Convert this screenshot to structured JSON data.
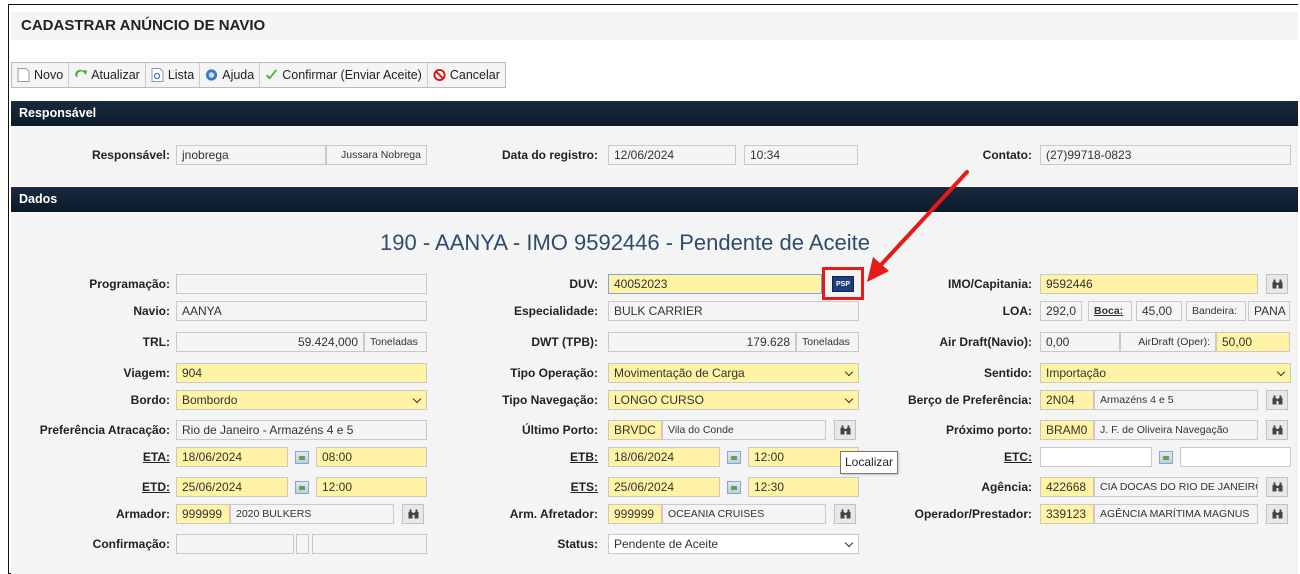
{
  "page_title": "CADASTRAR ANÚNCIO DE NAVIO",
  "toolbar": {
    "novo": "Novo",
    "atualizar": "Atualizar",
    "lista": "Lista",
    "ajuda": "Ajuda",
    "confirmar": "Confirmar (Enviar Aceite)",
    "cancelar": "Cancelar"
  },
  "responsavel_section": {
    "title": "Responsável",
    "responsavel_label": "Responsável:",
    "responsavel_user": "jnobrega",
    "responsavel_name": "Jussara Nobrega",
    "data_label": "Data do registro:",
    "data": "12/06/2024",
    "hora": "10:34",
    "contato_label": "Contato:",
    "contato": "(27)99718-0823"
  },
  "dados_section": {
    "title": "Dados",
    "heading": "190 - AANYA - IMO 9592446 - Pendente de Aceite"
  },
  "col1": {
    "programacao_label": "Programação:",
    "programacao": "",
    "navio_label": "Navio:",
    "navio": "AANYA",
    "trl_label": "TRL:",
    "trl": "59.424,000",
    "trl_unit": "Toneladas",
    "viagem_label": "Viagem:",
    "viagem": "904",
    "bordo_label": "Bordo:",
    "bordo": "Bombordo",
    "pref_label": "Preferência Atracação:",
    "pref": "Rio de Janeiro - Armazéns 4 e 5",
    "eta_label": "ETA:",
    "eta_date": "18/06/2024",
    "eta_time": "08:00",
    "etd_label": "ETD:",
    "etd_date": "25/06/2024",
    "etd_time": "12:00",
    "armador_label": "Armador:",
    "armador_code": "999999",
    "armador_name": "2020 BULKERS",
    "confirmacao_label": "Confirmação:"
  },
  "col2": {
    "duv_label": "DUV:",
    "duv": "40052023",
    "especialidade_label": "Especialidade:",
    "especialidade": "BULK CARRIER",
    "dwt_label": "DWT (TPB):",
    "dwt": "179.628",
    "dwt_unit": "Toneladas",
    "tipo_op_label": "Tipo Operação:",
    "tipo_op": "Movimentação de Carga",
    "tipo_nav_label": "Tipo Navegação:",
    "tipo_nav": "LONGO CURSO",
    "ultimo_porto_label": "Último Porto:",
    "ultimo_porto_code": "BRVDC",
    "ultimo_porto_name": "Vila do Conde",
    "etb_label": "ETB:",
    "etb_date": "18/06/2024",
    "etb_time": "12:00",
    "ets_label": "ETS:",
    "ets_date": "25/06/2024",
    "ets_time": "12:30",
    "arm_afretador_label": "Arm. Afretador:",
    "arm_afretador_code": "999999",
    "arm_afretador_name": "OCEANIA CRUISES",
    "status_label": "Status:",
    "status": "Pendente de Aceite"
  },
  "col3": {
    "imo_label": "IMO/Capitania:",
    "imo": "9592446",
    "loa_label": "LOA:",
    "loa": "292,0",
    "boca_label": "Boca:",
    "boca": "45,00",
    "bandeira_label": "Bandeira:",
    "bandeira": "PANA",
    "air_draft_label": "Air Draft(Navio):",
    "air_draft": "0,00",
    "air_draft_oper_label": "AirDraft (Oper):",
    "air_draft_oper": "50,00",
    "sentido_label": "Sentido:",
    "sentido": "Importação",
    "berco_label": "Berço de Preferência:",
    "berco_code": "2N04",
    "berco_name": "Armazéns 4 e 5",
    "proximo_label": "Próximo porto:",
    "proximo_code": "BRAM0",
    "proximo_name": "J. F. de Oliveira Navegação",
    "etc_label": "ETC:",
    "agencia_label": "Agência:",
    "agencia_code": "422668",
    "agencia_name": "CIA DOCAS DO RIO DE JANEIRO",
    "operador_label": "Operador/Prestador:",
    "operador_code": "339123",
    "operador_name": "AGÊNCIA MARÍTIMA MAGNUS"
  },
  "tooltip": "Localizar",
  "duv_button_text": "PSP",
  "colors": {
    "section_header": "#0b1a2b",
    "required_field": "#fff3a6",
    "heading": "#2e4c6d",
    "arrow": "#e31b1b"
  }
}
